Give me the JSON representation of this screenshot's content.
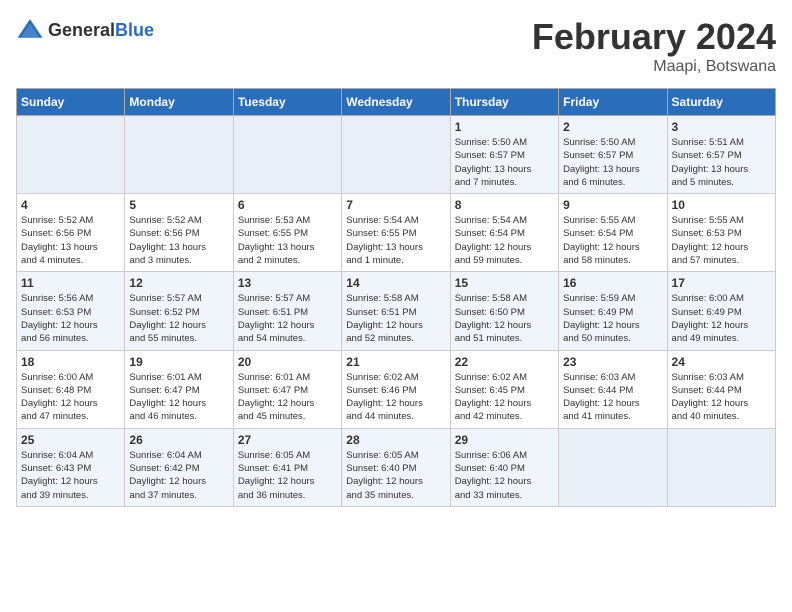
{
  "logo": {
    "general": "General",
    "blue": "Blue"
  },
  "header": {
    "month_year": "February 2024",
    "location": "Maapi, Botswana"
  },
  "days_of_week": [
    "Sunday",
    "Monday",
    "Tuesday",
    "Wednesday",
    "Thursday",
    "Friday",
    "Saturday"
  ],
  "weeks": [
    [
      {
        "day": "",
        "detail": ""
      },
      {
        "day": "",
        "detail": ""
      },
      {
        "day": "",
        "detail": ""
      },
      {
        "day": "",
        "detail": ""
      },
      {
        "day": "1",
        "detail": "Sunrise: 5:50 AM\nSunset: 6:57 PM\nDaylight: 13 hours\nand 7 minutes."
      },
      {
        "day": "2",
        "detail": "Sunrise: 5:50 AM\nSunset: 6:57 PM\nDaylight: 13 hours\nand 6 minutes."
      },
      {
        "day": "3",
        "detail": "Sunrise: 5:51 AM\nSunset: 6:57 PM\nDaylight: 13 hours\nand 5 minutes."
      }
    ],
    [
      {
        "day": "4",
        "detail": "Sunrise: 5:52 AM\nSunset: 6:56 PM\nDaylight: 13 hours\nand 4 minutes."
      },
      {
        "day": "5",
        "detail": "Sunrise: 5:52 AM\nSunset: 6:56 PM\nDaylight: 13 hours\nand 3 minutes."
      },
      {
        "day": "6",
        "detail": "Sunrise: 5:53 AM\nSunset: 6:55 PM\nDaylight: 13 hours\nand 2 minutes."
      },
      {
        "day": "7",
        "detail": "Sunrise: 5:54 AM\nSunset: 6:55 PM\nDaylight: 13 hours\nand 1 minute."
      },
      {
        "day": "8",
        "detail": "Sunrise: 5:54 AM\nSunset: 6:54 PM\nDaylight: 12 hours\nand 59 minutes."
      },
      {
        "day": "9",
        "detail": "Sunrise: 5:55 AM\nSunset: 6:54 PM\nDaylight: 12 hours\nand 58 minutes."
      },
      {
        "day": "10",
        "detail": "Sunrise: 5:55 AM\nSunset: 6:53 PM\nDaylight: 12 hours\nand 57 minutes."
      }
    ],
    [
      {
        "day": "11",
        "detail": "Sunrise: 5:56 AM\nSunset: 6:53 PM\nDaylight: 12 hours\nand 56 minutes."
      },
      {
        "day": "12",
        "detail": "Sunrise: 5:57 AM\nSunset: 6:52 PM\nDaylight: 12 hours\nand 55 minutes."
      },
      {
        "day": "13",
        "detail": "Sunrise: 5:57 AM\nSunset: 6:51 PM\nDaylight: 12 hours\nand 54 minutes."
      },
      {
        "day": "14",
        "detail": "Sunrise: 5:58 AM\nSunset: 6:51 PM\nDaylight: 12 hours\nand 52 minutes."
      },
      {
        "day": "15",
        "detail": "Sunrise: 5:58 AM\nSunset: 6:50 PM\nDaylight: 12 hours\nand 51 minutes."
      },
      {
        "day": "16",
        "detail": "Sunrise: 5:59 AM\nSunset: 6:49 PM\nDaylight: 12 hours\nand 50 minutes."
      },
      {
        "day": "17",
        "detail": "Sunrise: 6:00 AM\nSunset: 6:49 PM\nDaylight: 12 hours\nand 49 minutes."
      }
    ],
    [
      {
        "day": "18",
        "detail": "Sunrise: 6:00 AM\nSunset: 6:48 PM\nDaylight: 12 hours\nand 47 minutes."
      },
      {
        "day": "19",
        "detail": "Sunrise: 6:01 AM\nSunset: 6:47 PM\nDaylight: 12 hours\nand 46 minutes."
      },
      {
        "day": "20",
        "detail": "Sunrise: 6:01 AM\nSunset: 6:47 PM\nDaylight: 12 hours\nand 45 minutes."
      },
      {
        "day": "21",
        "detail": "Sunrise: 6:02 AM\nSunset: 6:46 PM\nDaylight: 12 hours\nand 44 minutes."
      },
      {
        "day": "22",
        "detail": "Sunrise: 6:02 AM\nSunset: 6:45 PM\nDaylight: 12 hours\nand 42 minutes."
      },
      {
        "day": "23",
        "detail": "Sunrise: 6:03 AM\nSunset: 6:44 PM\nDaylight: 12 hours\nand 41 minutes."
      },
      {
        "day": "24",
        "detail": "Sunrise: 6:03 AM\nSunset: 6:44 PM\nDaylight: 12 hours\nand 40 minutes."
      }
    ],
    [
      {
        "day": "25",
        "detail": "Sunrise: 6:04 AM\nSunset: 6:43 PM\nDaylight: 12 hours\nand 39 minutes."
      },
      {
        "day": "26",
        "detail": "Sunrise: 6:04 AM\nSunset: 6:42 PM\nDaylight: 12 hours\nand 37 minutes."
      },
      {
        "day": "27",
        "detail": "Sunrise: 6:05 AM\nSunset: 6:41 PM\nDaylight: 12 hours\nand 36 minutes."
      },
      {
        "day": "28",
        "detail": "Sunrise: 6:05 AM\nSunset: 6:40 PM\nDaylight: 12 hours\nand 35 minutes."
      },
      {
        "day": "29",
        "detail": "Sunrise: 6:06 AM\nSunset: 6:40 PM\nDaylight: 12 hours\nand 33 minutes."
      },
      {
        "day": "",
        "detail": ""
      },
      {
        "day": "",
        "detail": ""
      }
    ]
  ]
}
